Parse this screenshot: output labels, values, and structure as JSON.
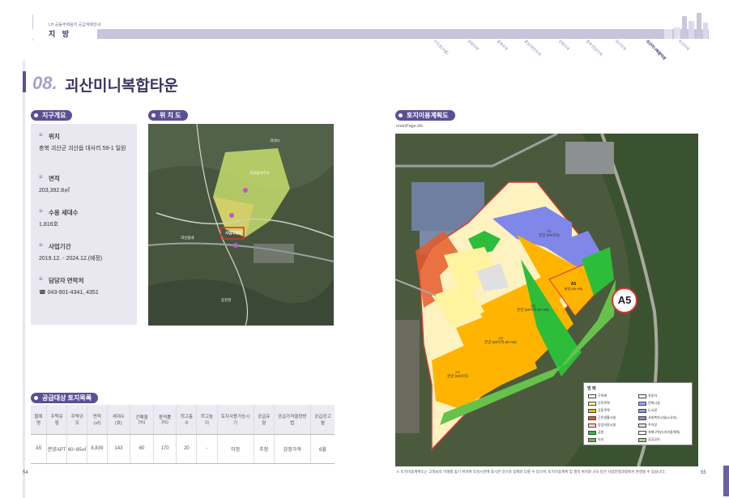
{
  "header": {
    "small_caption": "LH 공동주택용지 공급계획안내",
    "title": "지 방",
    "nav": [
      "수도권(서울)",
      "강원지역",
      "충북지역",
      "충남/대전지역",
      "전북지역",
      "광주/전남지역",
      "대구지역",
      "괴산미니복합타운",
      "부산지역"
    ],
    "active_nav_index": 7
  },
  "section": {
    "number": "08.",
    "title": "괴산미니복합타운"
  },
  "overview": {
    "heading": "지구개요",
    "items": [
      {
        "label": "위치",
        "value": "충북 괴산군 괴산읍 대사리 59-1 일원"
      },
      {
        "label": "면적",
        "value": "203,392.8㎡"
      },
      {
        "label": "수용 세대수",
        "value": "1,816호"
      },
      {
        "label": "사업기간",
        "value": "2019.12. - 2024.12.(예정)"
      },
      {
        "label": "담당자 연락처",
        "value": "☎ 043-901-4341, 4351"
      }
    ]
  },
  "location_map": {
    "heading": "위 치 도",
    "labels": [
      "괴산읍사무소",
      "괴산읍내",
      "사업대상지",
      "괴산IC",
      "동진천"
    ]
  },
  "land_use_plan": {
    "heading": "토지이용계획도",
    "filename": "mainPage.dtc",
    "callout": "A5",
    "blocks": [
      {
        "id": "A1",
        "text": "분양 (60이하)"
      },
      {
        "id": "A2",
        "text": "분양 (60이하,60~85)"
      },
      {
        "id": "A3",
        "text": "분양 (60이하,60~85)"
      },
      {
        "id": "A4",
        "text": "분양 (60이하)"
      },
      {
        "id": "A5",
        "text": "분양 (60~85)"
      }
    ],
    "legend_title": "범 례",
    "legend": [
      {
        "label": "구역계",
        "color": "#ffffff"
      },
      {
        "label": "자동차",
        "color": "#ffffff"
      },
      {
        "label": "단독주택",
        "color": "#fff3a0"
      },
      {
        "label": "문화시설",
        "color": "#9aa8ff"
      },
      {
        "label": "공동주택",
        "color": "#ffb400"
      },
      {
        "label": "도서관",
        "color": "#8f9fe0"
      },
      {
        "label": "근린생활시설",
        "color": "#e55a2b"
      },
      {
        "label": "사회복지시설(노유자)",
        "color": "#7f8fd8"
      },
      {
        "label": "상업지원시설",
        "color": "#ffd9c0"
      },
      {
        "label": "주차장",
        "color": "#e0e0e0"
      },
      {
        "label": "공원",
        "color": "#2dbd3a"
      },
      {
        "label": "차폐구역(녹지이용계획)",
        "color": "#ffffff"
      },
      {
        "label": "녹지",
        "color": "#66c24a"
      },
      {
        "label": "공공공지",
        "color": "#aede7c"
      }
    ],
    "footnote": "※ 토지이용계획도는 고객님의 이해를 돕기 위하여 작성시한에 표시한 것으로 실제와 다를 수 있으며, 토지이용계획 및 필지 위치와 규모 등은 사업진행과정에서 변경될 수 있습니다."
  },
  "supply_table": {
    "heading": "공급대상 토지목록",
    "columns": [
      "블록명",
      "주택유형",
      "주택규모",
      "면적(㎡)",
      "세대수(호)",
      "건폐율(%)",
      "용적률(%)",
      "최고층수",
      "최고높이",
      "토지사용가능시기",
      "공급유형",
      "공급가격결정방법",
      "공급공고월"
    ],
    "rows": [
      [
        "A5",
        "분양APT",
        "60~85㎡",
        "8,839",
        "143",
        "60",
        "170",
        "20",
        "-",
        "미정",
        "추첨",
        "감정가격",
        "6월"
      ]
    ]
  },
  "pages": {
    "left": "54",
    "right": "55"
  }
}
